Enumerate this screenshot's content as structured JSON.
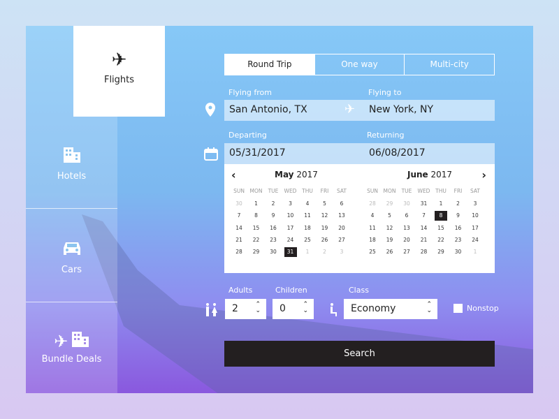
{
  "sidebar": {
    "items": [
      {
        "label": "Flights",
        "icon": "airplane-icon"
      },
      {
        "label": "Hotels",
        "icon": "building-icon"
      },
      {
        "label": "Cars",
        "icon": "car-icon"
      },
      {
        "label": "Bundle Deals",
        "icon": "airplane-building-icon"
      }
    ]
  },
  "trip_tabs": [
    "Round Trip",
    "One way",
    "Multi-city"
  ],
  "from": {
    "label": "Flying from",
    "value": "San Antonio, TX"
  },
  "to": {
    "label": "Flying to",
    "value": "New York, NY"
  },
  "departing": {
    "label": "Departing",
    "value": "05/31/2017"
  },
  "returning": {
    "label": "Returning",
    "value": "06/08/2017"
  },
  "calendar": {
    "weekdays": [
      "SUN",
      "MON",
      "TUE",
      "WED",
      "THU",
      "FRI",
      "SAT"
    ],
    "months": [
      {
        "month": "May",
        "year": "2017",
        "days": [
          "30",
          "1",
          "2",
          "3",
          "4",
          "5",
          "6",
          "7",
          "8",
          "9",
          "10",
          "11",
          "12",
          "13",
          "14",
          "15",
          "16",
          "17",
          "18",
          "19",
          "20",
          "21",
          "22",
          "23",
          "24",
          "25",
          "26",
          "27",
          "28",
          "29",
          "30",
          "31",
          "1",
          "2",
          "3"
        ],
        "muted": [
          0,
          32,
          33,
          34
        ],
        "selected": 31
      },
      {
        "month": "June",
        "year": "2017",
        "days": [
          "28",
          "29",
          "30",
          "31",
          "1",
          "2",
          "3",
          "4",
          "5",
          "6",
          "7",
          "8",
          "9",
          "10",
          "11",
          "12",
          "13",
          "14",
          "15",
          "16",
          "17",
          "18",
          "19",
          "20",
          "21",
          "22",
          "23",
          "24",
          "25",
          "26",
          "27",
          "28",
          "29",
          "30",
          "1"
        ],
        "muted": [
          0,
          1,
          2,
          34
        ],
        "selected": 11
      }
    ]
  },
  "adults": {
    "label": "Adults",
    "value": "2"
  },
  "children": {
    "label": "Children",
    "value": "0"
  },
  "class": {
    "label": "Class",
    "value": "Economy"
  },
  "nonstop": {
    "label": "Nonstop",
    "checked": false
  },
  "search_label": "Search",
  "colors": {
    "button": "#231f20",
    "selected_day": "#231f20"
  }
}
